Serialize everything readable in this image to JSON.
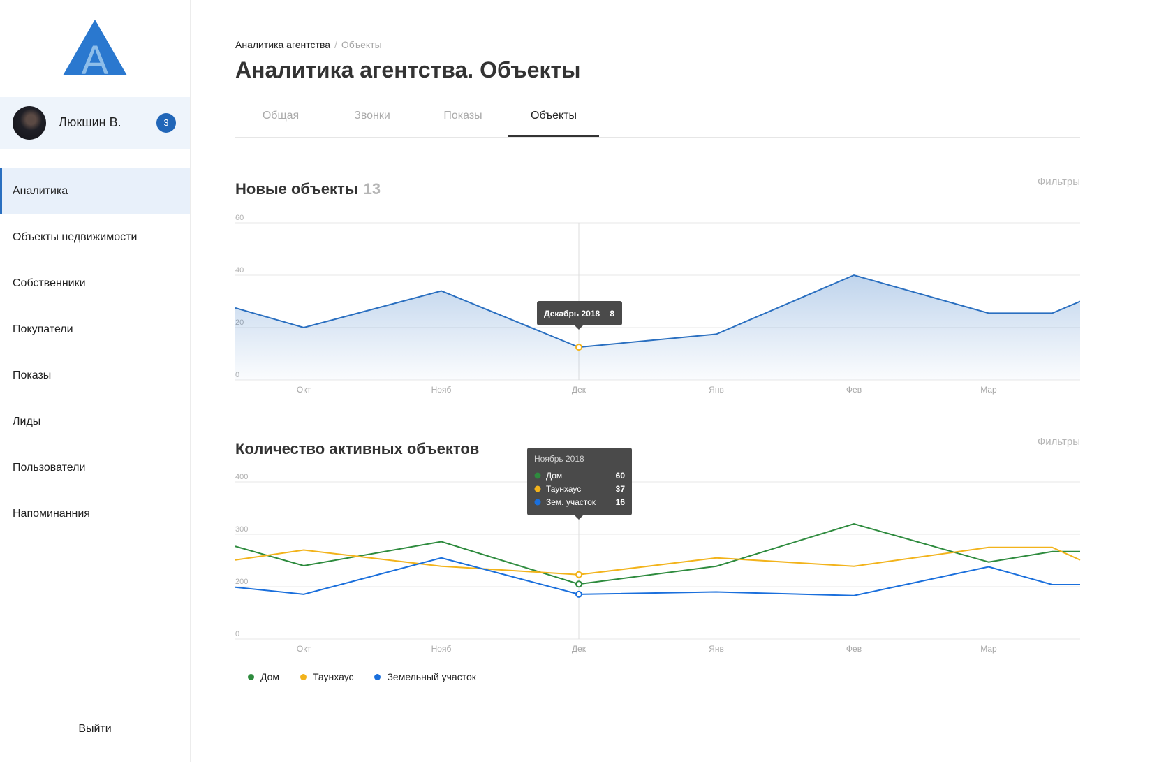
{
  "sidebar": {
    "logo_letter": "A",
    "user": {
      "name": "Люкшин В.",
      "badge": "3"
    },
    "items": [
      {
        "label": "Аналитика",
        "active": true
      },
      {
        "label": "Объекты недвижимости"
      },
      {
        "label": "Собственники"
      },
      {
        "label": "Покупатели"
      },
      {
        "label": "Показы"
      },
      {
        "label": "Лиды"
      },
      {
        "label": "Пользователи"
      },
      {
        "label": "Напоминанния"
      }
    ],
    "logout": "Выйти"
  },
  "breadcrumb": {
    "parent": "Аналитика агентства",
    "separator": "/",
    "current": "Объекты"
  },
  "page_title": "Аналитика агентства. Объекты",
  "tabs": [
    {
      "label": "Общая"
    },
    {
      "label": "Звонки"
    },
    {
      "label": "Показы"
    },
    {
      "label": "Объекты",
      "active": true
    }
  ],
  "colors": {
    "accent": "#2a6fc0",
    "green": "#2e8b3e",
    "yellow": "#f2b31b",
    "blue": "#1a6fdc",
    "tooltip_bg": "#4a4a4a"
  },
  "section1": {
    "title": "Новые объекты",
    "count": "13",
    "filters": "Фильтры"
  },
  "section2": {
    "title": "Количество активных объектов",
    "filters": "Фильтры"
  },
  "legend": [
    "Дом",
    "Таунхаус",
    "Земельный участок"
  ],
  "chart_data": [
    {
      "type": "area",
      "title": "Новые объекты",
      "x": [
        "Окт",
        "Нояб",
        "Дек",
        "Янв",
        "Фев",
        "Мар"
      ],
      "y_ticks": [
        0,
        20,
        40,
        60
      ],
      "ylim": [
        0,
        60
      ],
      "grid": true,
      "series": [
        {
          "values": [
            27.5,
            20,
            34,
            12.5,
            17.5,
            40,
            25.5,
            25.5,
            30
          ]
        }
      ],
      "tooltip": {
        "label": "Декабрь 2018",
        "value": "8"
      }
    },
    {
      "type": "line",
      "title": "Количество активных объектов",
      "x": [
        "Окт",
        "Нояб",
        "Дек",
        "Янв",
        "Фев",
        "Мар"
      ],
      "y_ticks": [
        0,
        200,
        300,
        400
      ],
      "grid": true,
      "legend_position": "bottom-left",
      "series": [
        {
          "name": "Дом",
          "color": "#2e8b3e",
          "values": [
            277,
            240,
            286,
            205,
            239,
            320,
            247,
            267,
            267
          ]
        },
        {
          "name": "Таунхаус",
          "color": "#f2b31b",
          "values": [
            251,
            270,
            239,
            223,
            255,
            239,
            275,
            275,
            251
          ]
        },
        {
          "name": "Земельный участок",
          "color": "#1a6fdc",
          "values": [
            198,
            171,
            255,
            171,
            180,
            166,
            238,
            204,
            204
          ]
        }
      ],
      "tooltip": {
        "label": "Ноябрь 2018",
        "rows": [
          {
            "name": "Дом",
            "value": "60"
          },
          {
            "name": "Таунхаус",
            "value": "37"
          },
          {
            "name": "Зем. участок",
            "value": "16"
          }
        ]
      }
    }
  ]
}
